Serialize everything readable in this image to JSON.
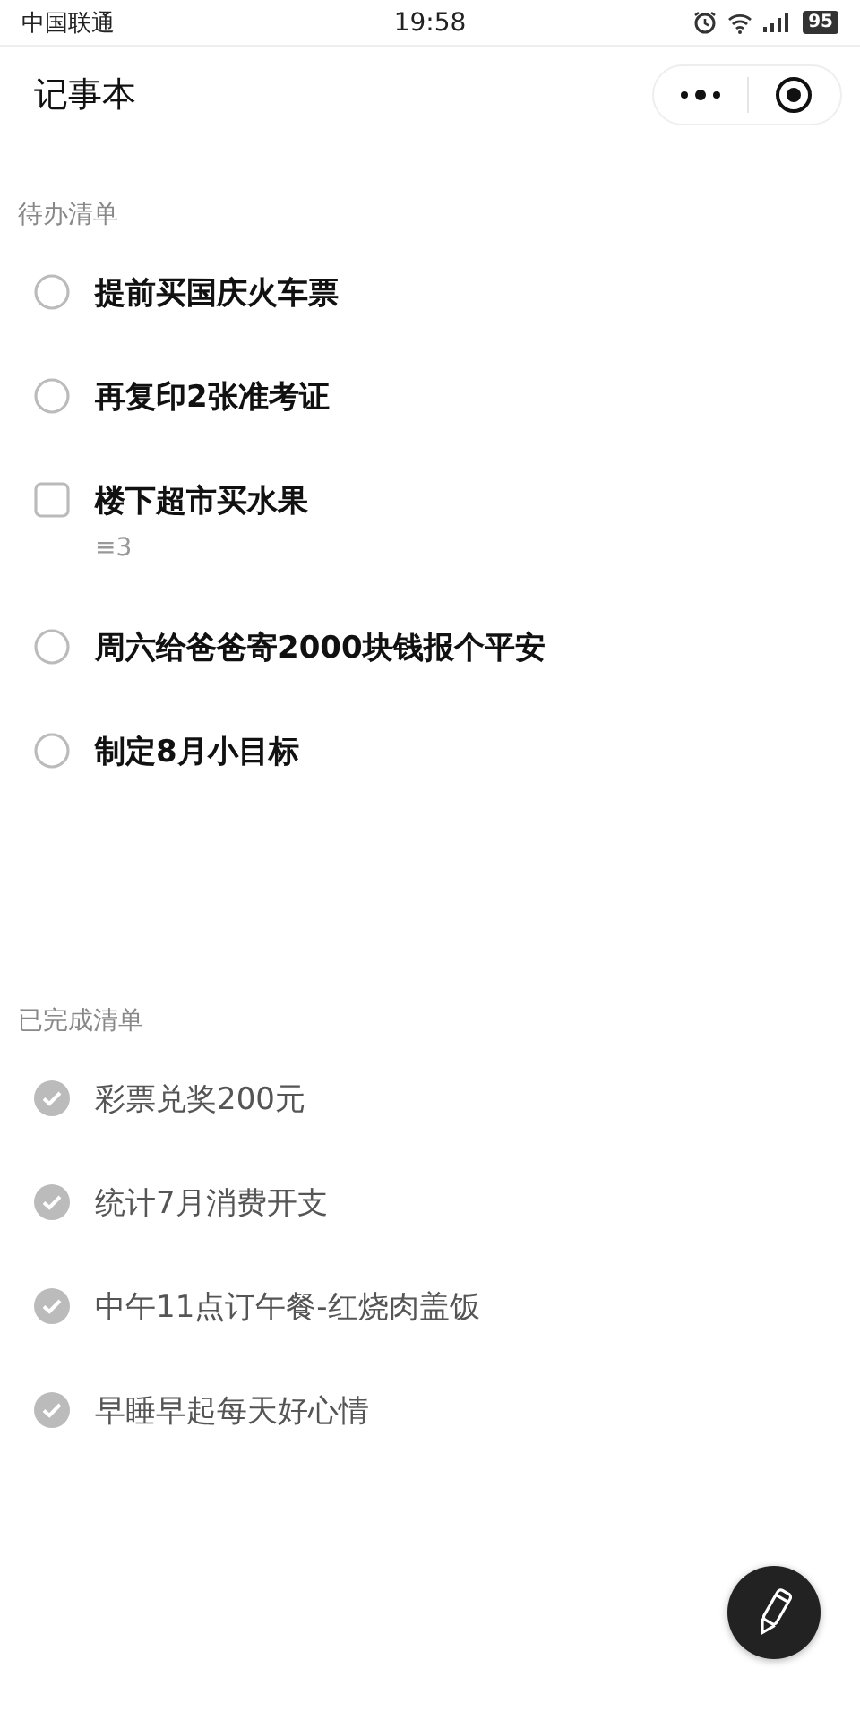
{
  "status_bar": {
    "carrier": "中国联通",
    "time": "19:58",
    "battery": "95"
  },
  "header": {
    "title": "记事本"
  },
  "sections": [
    {
      "title": "待办清单",
      "items": [
        {
          "kind": "task",
          "text": "提前买国庆火车票",
          "checked": false
        },
        {
          "kind": "task",
          "text": "再复印2张准考证",
          "checked": false
        },
        {
          "kind": "checklist",
          "text": "楼下超市买水果",
          "checked": false,
          "count": "≡3"
        },
        {
          "kind": "task",
          "text": "周六给爸爸寄2000块钱报个平安",
          "checked": false
        },
        {
          "kind": "task",
          "text": "制定8月小目标",
          "checked": false
        }
      ]
    },
    {
      "title": "已完成清单",
      "items": [
        {
          "kind": "task",
          "text": "彩票兑奖200元",
          "checked": true
        },
        {
          "kind": "task",
          "text": "统计7月消费开支",
          "checked": true
        },
        {
          "kind": "task",
          "text": "中午11点订午餐-红烧肉盖饭",
          "checked": true
        },
        {
          "kind": "task",
          "text": "早睡早起每天好心情",
          "checked": true
        }
      ]
    }
  ]
}
